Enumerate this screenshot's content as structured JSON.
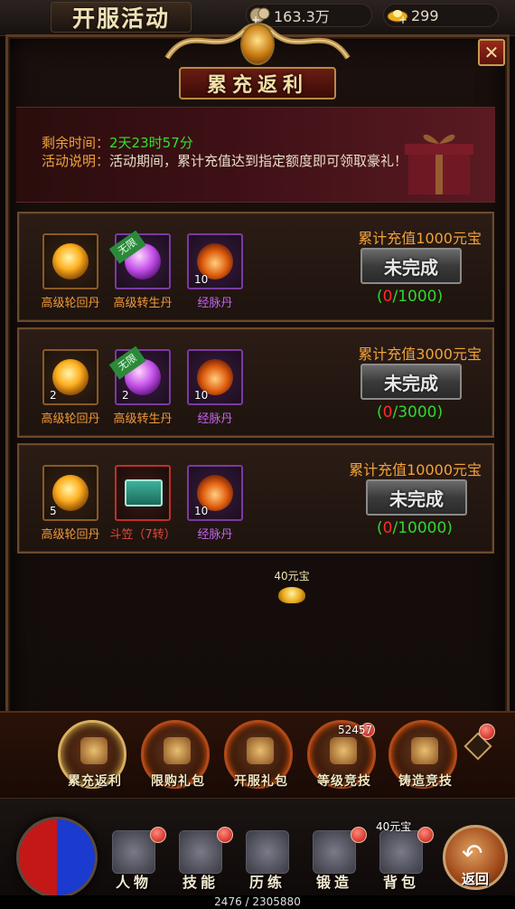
{
  "topbar": {
    "title": "开服活动",
    "currency1": "163.3万",
    "currency2": "299"
  },
  "panel": {
    "banner": "累充返利",
    "info": {
      "remaining_label": "剩余时间：",
      "remaining_value": "2天23时57分",
      "desc_label": "活动说明：",
      "desc_value": "活动期间，累计充值达到指定额度即可领取豪礼！"
    }
  },
  "rows": [
    {
      "requirement": "累计充值1000元宝",
      "button": "未完成",
      "progress_open": "(",
      "progress_current": "0",
      "progress_total": "/1000)",
      "items": [
        {
          "name": "高级轮回丹",
          "count": "",
          "tag": ""
        },
        {
          "name": "高级转生丹",
          "count": "",
          "tag": "无限"
        },
        {
          "name": "经脉丹",
          "count": "10",
          "tag": ""
        }
      ]
    },
    {
      "requirement": "累计充值3000元宝",
      "button": "未完成",
      "progress_open": "(",
      "progress_current": "0",
      "progress_total": "/3000)",
      "items": [
        {
          "name": "高级轮回丹",
          "count": "2",
          "tag": ""
        },
        {
          "name": "高级转生丹",
          "count": "2",
          "tag": "无限"
        },
        {
          "name": "经脉丹",
          "count": "10",
          "tag": ""
        }
      ]
    },
    {
      "requirement": "累计充值10000元宝",
      "button": "未完成",
      "progress_open": "(",
      "progress_current": "0",
      "progress_total": "/10000)",
      "items": [
        {
          "name": "高级轮回丹",
          "count": "5",
          "tag": ""
        },
        {
          "name": "斗笠（7转）",
          "count": "",
          "tag": ""
        },
        {
          "name": "经脉丹",
          "count": "10",
          "tag": ""
        }
      ]
    }
  ],
  "floating_reward": "40元宝",
  "tabs": [
    {
      "label": "累充返利"
    },
    {
      "label": "限购礼包"
    },
    {
      "label": "开服礼包"
    },
    {
      "label": "等级竞技"
    },
    {
      "label": "铸造竞技"
    }
  ],
  "tab_counter": "52457",
  "bottomnav": {
    "items": [
      {
        "label": "人物"
      },
      {
        "label": "技能"
      },
      {
        "label": "历练"
      },
      {
        "label": "锻造"
      },
      {
        "label": "背包"
      }
    ],
    "bag_reward": "40元宝",
    "return_label": "返回",
    "exp": "2476 / 2305880"
  }
}
